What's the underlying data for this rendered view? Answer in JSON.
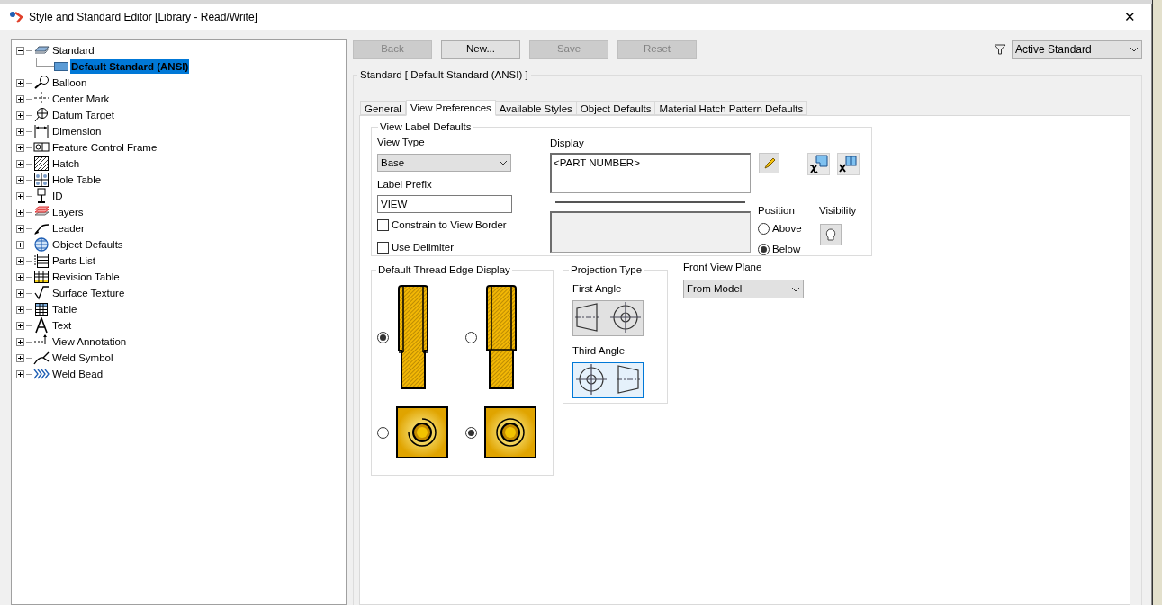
{
  "window": {
    "title": "Style and Standard Editor [Library - Read/Write]",
    "close": "✕"
  },
  "tree": [
    {
      "label": "Standard",
      "expanded": true,
      "selected": false,
      "children": [
        {
          "label": "Default Standard (ANSI)",
          "selected": true
        }
      ]
    },
    {
      "label": "Balloon",
      "expanded": false,
      "selected": false
    },
    {
      "label": "Center Mark",
      "expanded": false,
      "selected": false
    },
    {
      "label": "Datum Target",
      "expanded": false,
      "selected": false
    },
    {
      "label": "Dimension",
      "expanded": false,
      "selected": false
    },
    {
      "label": "Feature Control Frame",
      "expanded": false,
      "selected": false
    },
    {
      "label": "Hatch",
      "expanded": false,
      "selected": false
    },
    {
      "label": "Hole Table",
      "expanded": false,
      "selected": false
    },
    {
      "label": "ID",
      "expanded": false,
      "selected": false
    },
    {
      "label": "Layers",
      "expanded": false,
      "selected": false
    },
    {
      "label": "Leader",
      "expanded": false,
      "selected": false
    },
    {
      "label": "Object Defaults",
      "expanded": false,
      "selected": false
    },
    {
      "label": "Parts List",
      "expanded": false,
      "selected": false
    },
    {
      "label": "Revision Table",
      "expanded": false,
      "selected": false
    },
    {
      "label": "Surface Texture",
      "expanded": false,
      "selected": false
    },
    {
      "label": "Table",
      "expanded": false,
      "selected": false
    },
    {
      "label": "Text",
      "expanded": false,
      "selected": false
    },
    {
      "label": "View Annotation",
      "expanded": false,
      "selected": false
    },
    {
      "label": "Weld Symbol",
      "expanded": false,
      "selected": false
    },
    {
      "label": "Weld Bead",
      "expanded": false,
      "selected": false
    }
  ],
  "toolbar": {
    "buttons": [
      {
        "label": "Back",
        "disabled": true
      },
      {
        "label": "New...",
        "disabled": false
      },
      {
        "label": "Save",
        "disabled": true
      },
      {
        "label": "Reset",
        "disabled": true
      }
    ],
    "filter": {
      "value": "Active Standard"
    }
  },
  "group_title": "Standard [ Default Standard (ANSI) ]",
  "tabs": [
    {
      "label": "General",
      "selected": false
    },
    {
      "label": "View Preferences",
      "selected": true
    },
    {
      "label": "Available Styles",
      "selected": false
    },
    {
      "label": "Object Defaults",
      "selected": false
    },
    {
      "label": "Material Hatch Pattern Defaults",
      "selected": false
    }
  ],
  "view_label_defaults": {
    "title": "View Label Defaults",
    "view_type_label": "View Type",
    "view_type_value": "Base",
    "label_prefix_label": "Label Prefix",
    "label_prefix_value": "VIEW",
    "checkboxes": [
      {
        "label": "Constrain to View Border",
        "checked": false
      },
      {
        "label": "Use Delimiter",
        "checked": false
      }
    ],
    "display_label": "Display",
    "display_value": "<PART NUMBER>",
    "position_label": "Position",
    "positions": [
      {
        "label": "Above",
        "selected": false
      },
      {
        "label": "Below",
        "selected": true
      }
    ],
    "visibility_label": "Visibility"
  },
  "thread_edge": {
    "title": "Default Thread Edge Display",
    "options": [
      {
        "kind": "side",
        "selected": true
      },
      {
        "kind": "side",
        "selected": false
      },
      {
        "kind": "end",
        "selected": false
      },
      {
        "kind": "end",
        "selected": true
      }
    ]
  },
  "projection": {
    "title": "Projection Type",
    "options": [
      {
        "label": "First Angle",
        "selected": false
      },
      {
        "label": "Third Angle",
        "selected": true
      }
    ]
  },
  "front_view_plane": {
    "label": "Front View Plane",
    "value": "From Model"
  }
}
